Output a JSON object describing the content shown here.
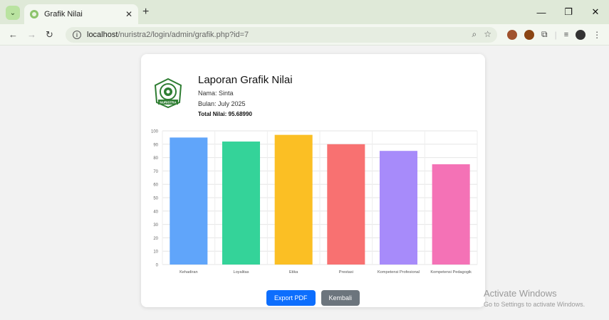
{
  "browser": {
    "tab_title": "Grafik Nilai",
    "url_host": "localhost",
    "url_path": "/nuristra2/login/admin/grafik.php?id=7"
  },
  "report": {
    "title": "Laporan Grafik Nilai",
    "nama": "Nama: Sinta",
    "bulan": "Bulan: July 2025",
    "total": "Total Nilai: 95.68990",
    "logo_text": "NURISTRA"
  },
  "buttons": {
    "export_pdf": "Export PDF",
    "kembali": "Kembali"
  },
  "watermark": {
    "title": "Activate Windows",
    "subtitle": "Go to Settings to activate Windows."
  },
  "colors": {
    "export_button": "#0d6efd",
    "back_button": "#6c757d"
  },
  "chart_data": {
    "type": "bar",
    "categories": [
      "Kehadiran",
      "Loyalitas",
      "Etika",
      "Prestasi",
      "Kompetensi Profesional",
      "Kompetensi Pedagogik"
    ],
    "values": [
      95,
      92,
      97,
      90,
      85,
      75
    ],
    "colors": [
      "#60a5fa",
      "#34d399",
      "#fbbf24",
      "#f87171",
      "#a78bfa",
      "#f472b6"
    ],
    "yticks": [
      0,
      10,
      20,
      30,
      40,
      50,
      60,
      70,
      80,
      90,
      100
    ],
    "ylim": [
      0,
      100
    ],
    "grid": true
  }
}
